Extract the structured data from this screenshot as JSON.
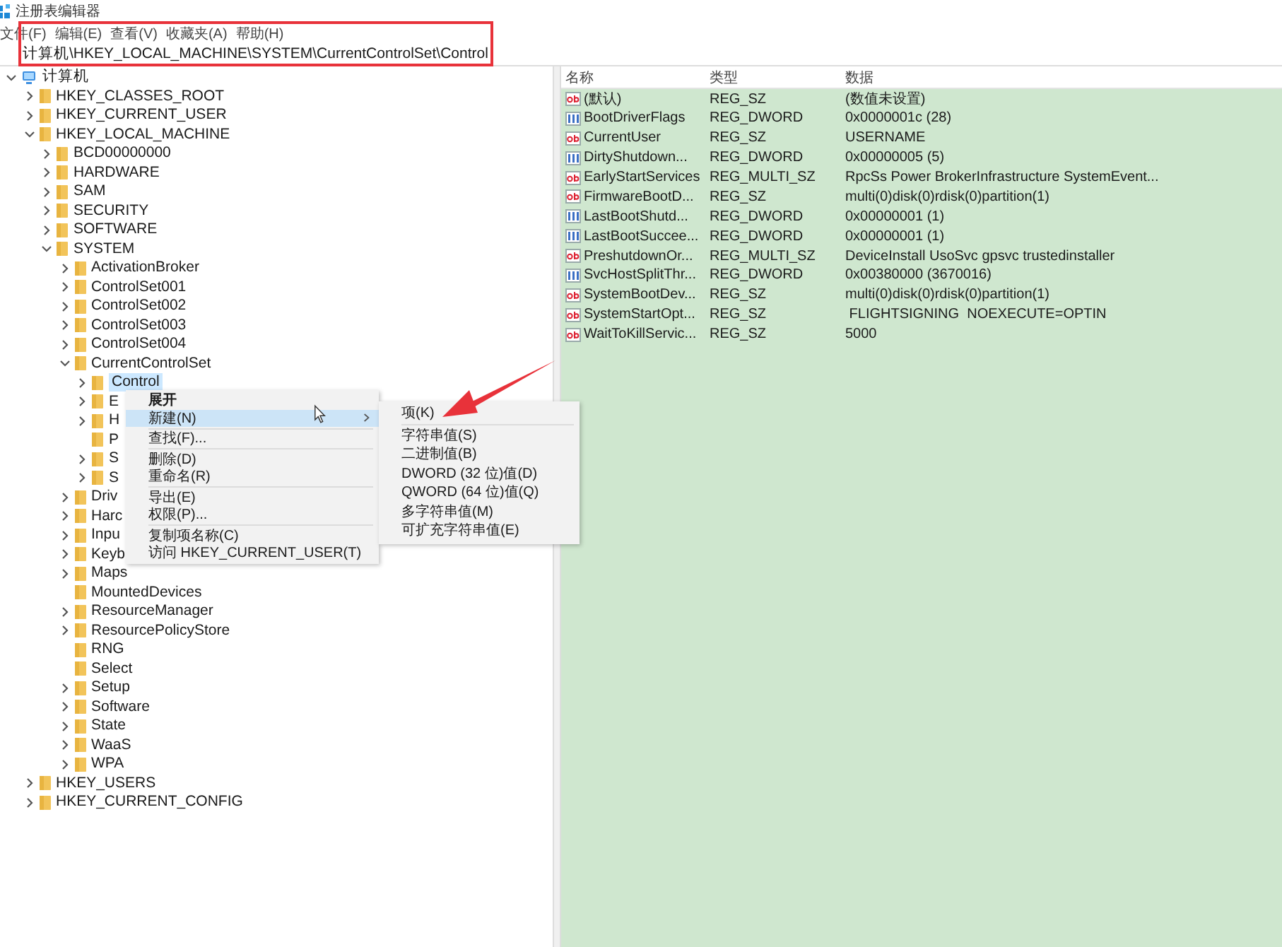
{
  "window": {
    "title": "注册表编辑器"
  },
  "menu_bar": [
    "文件(F)",
    "编辑(E)",
    "查看(V)",
    "收藏夹(A)",
    "帮助(H)"
  ],
  "address": "计算机\\HKEY_LOCAL_MACHINE\\SYSTEM\\CurrentControlSet\\Control",
  "tree": [
    {
      "label": "计算机",
      "expandable": true,
      "expanded": true,
      "selected": false,
      "children": [
        {
          "label": "HKEY_CLASSES_ROOT",
          "expandable": true,
          "expanded": false,
          "selected": false
        },
        {
          "label": "HKEY_CURRENT_USER",
          "expandable": true,
          "expanded": false,
          "selected": false
        },
        {
          "label": "HKEY_LOCAL_MACHINE",
          "expandable": true,
          "expanded": true,
          "selected": false,
          "children": [
            {
              "label": "BCD00000000",
              "expandable": true,
              "expanded": false,
              "selected": false
            },
            {
              "label": "HARDWARE",
              "expandable": true,
              "expanded": false,
              "selected": false
            },
            {
              "label": "SAM",
              "expandable": true,
              "expanded": false,
              "selected": false
            },
            {
              "label": "SECURITY",
              "expandable": true,
              "expanded": false,
              "selected": false
            },
            {
              "label": "SOFTWARE",
              "expandable": true,
              "expanded": false,
              "selected": false
            },
            {
              "label": "SYSTEM",
              "expandable": true,
              "expanded": true,
              "selected": false,
              "children": [
                {
                  "label": "ActivationBroker",
                  "expandable": true,
                  "expanded": false,
                  "selected": false
                },
                {
                  "label": "ControlSet001",
                  "expandable": true,
                  "expanded": false,
                  "selected": false
                },
                {
                  "label": "ControlSet002",
                  "expandable": true,
                  "expanded": false,
                  "selected": false
                },
                {
                  "label": "ControlSet003",
                  "expandable": true,
                  "expanded": false,
                  "selected": false
                },
                {
                  "label": "ControlSet004",
                  "expandable": true,
                  "expanded": false,
                  "selected": false
                },
                {
                  "label": "CurrentControlSet",
                  "expandable": true,
                  "expanded": true,
                  "selected": false,
                  "children": [
                    {
                      "label": "Control",
                      "expandable": true,
                      "expanded": false,
                      "selected": true
                    },
                    {
                      "label": "E",
                      "expandable": true,
                      "expanded": false,
                      "selected": false
                    },
                    {
                      "label": "H",
                      "expandable": true,
                      "expanded": false,
                      "selected": false
                    },
                    {
                      "label": "P",
                      "expandable": false,
                      "selected": false
                    },
                    {
                      "label": "S",
                      "expandable": true,
                      "expanded": false,
                      "selected": false
                    },
                    {
                      "label": "S",
                      "expandable": true,
                      "expanded": false,
                      "selected": false
                    }
                  ]
                },
                {
                  "label": "Driv",
                  "expandable": true,
                  "expanded": false,
                  "selected": false
                },
                {
                  "label": "Harc",
                  "expandable": true,
                  "expanded": false,
                  "selected": false
                },
                {
                  "label": "Inpu",
                  "expandable": true,
                  "expanded": false,
                  "selected": false
                },
                {
                  "label": "Keyb",
                  "expandable": true,
                  "expanded": false,
                  "selected": false
                },
                {
                  "label": "Maps",
                  "expandable": true,
                  "expanded": false,
                  "selected": false
                },
                {
                  "label": "MountedDevices",
                  "expandable": false,
                  "selected": false
                },
                {
                  "label": "ResourceManager",
                  "expandable": true,
                  "expanded": false,
                  "selected": false
                },
                {
                  "label": "ResourcePolicyStore",
                  "expandable": true,
                  "expanded": false,
                  "selected": false
                },
                {
                  "label": "RNG",
                  "expandable": false,
                  "selected": false
                },
                {
                  "label": "Select",
                  "expandable": false,
                  "selected": false
                },
                {
                  "label": "Setup",
                  "expandable": true,
                  "expanded": false,
                  "selected": false
                },
                {
                  "label": "Software",
                  "expandable": true,
                  "expanded": false,
                  "selected": false
                },
                {
                  "label": "State",
                  "expandable": true,
                  "expanded": false,
                  "selected": false
                },
                {
                  "label": "WaaS",
                  "expandable": true,
                  "expanded": false,
                  "selected": false
                },
                {
                  "label": "WPA",
                  "expandable": true,
                  "expanded": false,
                  "selected": false
                }
              ]
            }
          ]
        },
        {
          "label": "HKEY_USERS",
          "expandable": true,
          "expanded": false,
          "selected": false
        },
        {
          "label": "HKEY_CURRENT_CONFIG",
          "expandable": true,
          "expanded": false,
          "selected": false
        }
      ]
    }
  ],
  "values": {
    "columns": [
      "名称",
      "类型",
      "数据"
    ],
    "rows": [
      {
        "kind": "string",
        "name": "(默认)",
        "type": "REG_SZ",
        "data": "(数值未设置)"
      },
      {
        "kind": "binary",
        "name": "BootDriverFlags",
        "type": "REG_DWORD",
        "data": "0x0000001c (28)"
      },
      {
        "kind": "string",
        "name": "CurrentUser",
        "type": "REG_SZ",
        "data": "USERNAME"
      },
      {
        "kind": "binary",
        "name": "DirtyShutdown...",
        "type": "REG_DWORD",
        "data": "0x00000005 (5)"
      },
      {
        "kind": "string",
        "name": "EarlyStartServices",
        "type": "REG_MULTI_SZ",
        "data": "RpcSs Power BrokerInfrastructure SystemEvent..."
      },
      {
        "kind": "string",
        "name": "FirmwareBootD...",
        "type": "REG_SZ",
        "data": "multi(0)disk(0)rdisk(0)partition(1)"
      },
      {
        "kind": "binary",
        "name": "LastBootShutd...",
        "type": "REG_DWORD",
        "data": "0x00000001 (1)"
      },
      {
        "kind": "binary",
        "name": "LastBootSuccee...",
        "type": "REG_DWORD",
        "data": "0x00000001 (1)"
      },
      {
        "kind": "string",
        "name": "PreshutdownOr...",
        "type": "REG_MULTI_SZ",
        "data": "DeviceInstall UsoSvc gpsvc trustedinstaller"
      },
      {
        "kind": "binary",
        "name": "SvcHostSplitThr...",
        "type": "REG_DWORD",
        "data": "0x00380000 (3670016)"
      },
      {
        "kind": "string",
        "name": "SystemBootDev...",
        "type": "REG_SZ",
        "data": "multi(0)disk(0)rdisk(0)partition(1)"
      },
      {
        "kind": "string",
        "name": "SystemStartOpt...",
        "type": "REG_SZ",
        "data": " FLIGHTSIGNING  NOEXECUTE=OPTIN"
      },
      {
        "kind": "string",
        "name": "WaitToKillServic...",
        "type": "REG_SZ",
        "data": "5000"
      }
    ]
  },
  "context_menu": [
    {
      "kind": "item",
      "label": "展开",
      "default": true,
      "selected": false,
      "submenu": false
    },
    {
      "kind": "item",
      "label": "新建(N)",
      "default": false,
      "selected": true,
      "submenu": true
    },
    {
      "kind": "separator"
    },
    {
      "kind": "item",
      "label": "查找(F)...",
      "default": false,
      "selected": false,
      "submenu": false
    },
    {
      "kind": "separator"
    },
    {
      "kind": "item",
      "label": "删除(D)",
      "default": false,
      "selected": false,
      "submenu": false
    },
    {
      "kind": "item",
      "label": "重命名(R)",
      "default": false,
      "selected": false,
      "submenu": false
    },
    {
      "kind": "separator"
    },
    {
      "kind": "item",
      "label": "导出(E)",
      "default": false,
      "selected": false,
      "submenu": false
    },
    {
      "kind": "item",
      "label": "权限(P)...",
      "default": false,
      "selected": false,
      "submenu": false
    },
    {
      "kind": "separator"
    },
    {
      "kind": "item",
      "label": "复制项名称(C)",
      "default": false,
      "selected": false,
      "submenu": false
    },
    {
      "kind": "item",
      "label": "访问 HKEY_CURRENT_USER(T)",
      "default": false,
      "selected": false,
      "submenu": false
    }
  ],
  "submenu": [
    {
      "kind": "item",
      "label": "项(K)"
    },
    {
      "kind": "separator"
    },
    {
      "kind": "item",
      "label": "字符串值(S)"
    },
    {
      "kind": "item",
      "label": "二进制值(B)"
    },
    {
      "kind": "item",
      "label": "DWORD (32 位)值(D)"
    },
    {
      "kind": "item",
      "label": "QWORD (64 位)值(Q)"
    },
    {
      "kind": "item",
      "label": "多字符串值(M)"
    },
    {
      "kind": "item",
      "label": "可扩充字符串值(E)"
    }
  ]
}
